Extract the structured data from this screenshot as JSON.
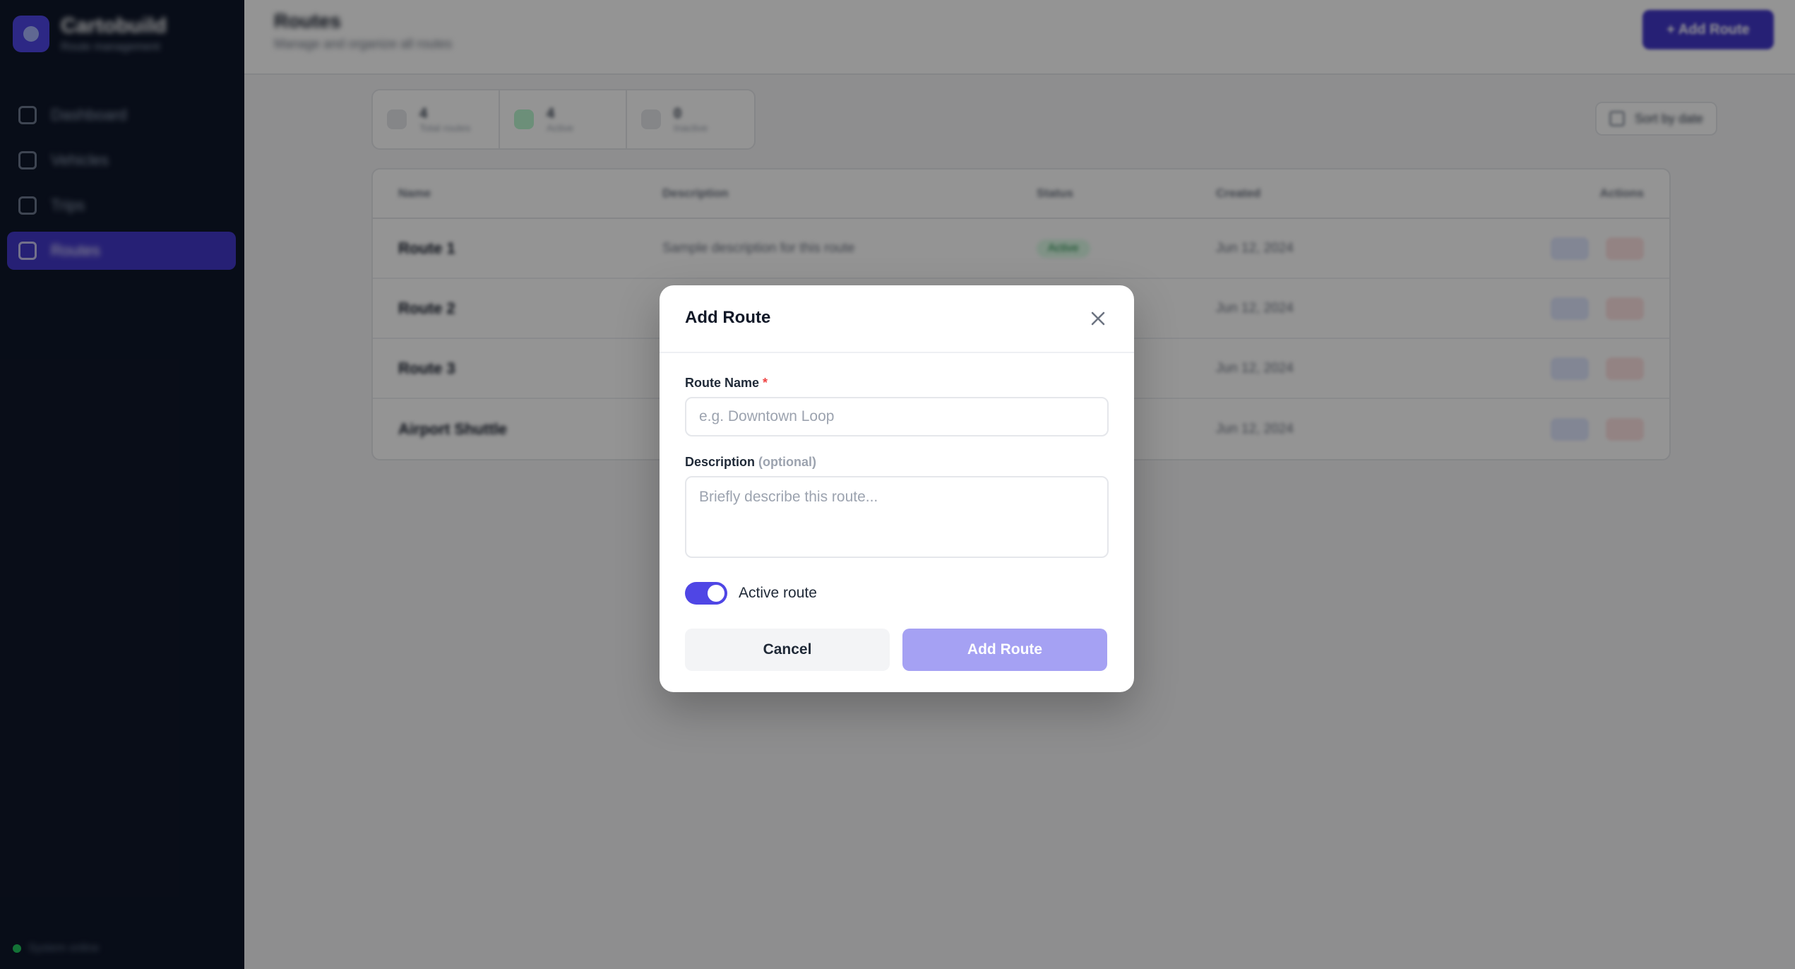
{
  "sidebar": {
    "brand_name": "Cartobuild",
    "brand_sub": "Route management",
    "items": [
      {
        "label": "Dashboard",
        "icon": "grid-icon"
      },
      {
        "label": "Vehicles",
        "icon": "truck-icon"
      },
      {
        "label": "Trips",
        "icon": "map-icon"
      },
      {
        "label": "Routes",
        "icon": "route-icon"
      }
    ],
    "footer": "System online"
  },
  "page": {
    "title": "Routes",
    "subtitle": "Manage and organize all routes",
    "primary_button": "+ Add Route"
  },
  "stats": [
    {
      "value": "4",
      "label": "Total routes"
    },
    {
      "value": "4",
      "label": "Active"
    },
    {
      "value": "0",
      "label": "Inactive"
    }
  ],
  "toolbar": {
    "filter_label": "Sort by date"
  },
  "table": {
    "headers": [
      "Name",
      "Description",
      "Status",
      "Created",
      "Actions"
    ],
    "rows": [
      {
        "name": "Route 1",
        "desc": "Sample description for this route",
        "status": "Active",
        "date": "Jun 12, 2024"
      },
      {
        "name": "Route 2",
        "desc": "",
        "status": "",
        "date": "Jun 12, 2024"
      },
      {
        "name": "Route 3",
        "desc": "",
        "status": "",
        "date": "Jun 12, 2024"
      },
      {
        "name": "Airport Shuttle",
        "desc": "",
        "status": "",
        "date": "Jun 12, 2024"
      }
    ]
  },
  "modal": {
    "title": "Add Route",
    "route_name_label": "Route Name",
    "required_mark": "*",
    "route_name_placeholder": "e.g. Downtown Loop",
    "description_label": "Description",
    "optional_mark": "(optional)",
    "description_placeholder": "Briefly describe this route...",
    "active_label": "Active route",
    "active_on": true,
    "cancel_label": "Cancel",
    "submit_label": "Add Route"
  },
  "colors": {
    "sidebar_bg": "#0f172a",
    "accent": "#4f46e5",
    "submit_disabled": "#a5a1f3",
    "danger": "#ef4444"
  }
}
